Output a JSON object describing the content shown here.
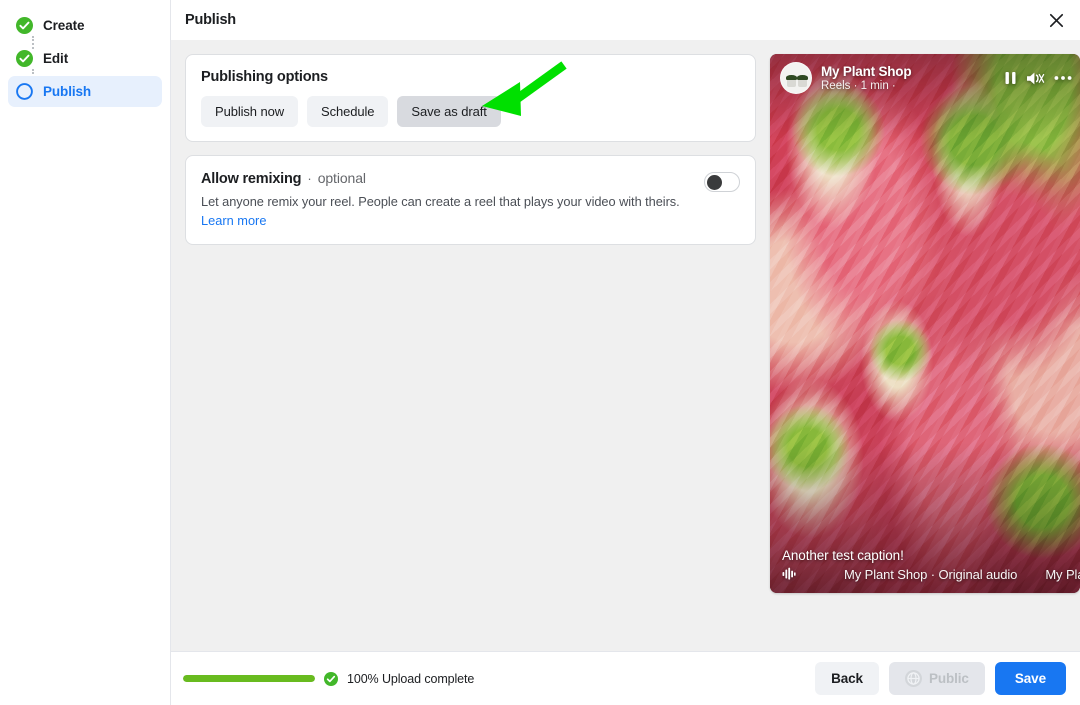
{
  "accent": {
    "blue": "#1877f2",
    "green": "#42b72a",
    "progress_green": "#68bb1f",
    "annotation_green": "#00e000",
    "selected_step_bg": "#e7f0fd"
  },
  "sidebar": {
    "steps": [
      {
        "label": "Create",
        "icon": "check-circle-filled-icon",
        "state": "complete"
      },
      {
        "label": "Edit",
        "icon": "check-circle-filled-icon",
        "state": "complete"
      },
      {
        "label": "Publish",
        "icon": "circle-outline-icon",
        "state": "active"
      }
    ]
  },
  "topbar": {
    "title": "Publish",
    "close_icon": "close-icon"
  },
  "publishing_options": {
    "title": "Publishing options",
    "buttons": [
      {
        "label": "Publish now",
        "selected": false
      },
      {
        "label": "Schedule",
        "selected": false
      },
      {
        "label": "Save as draft",
        "selected": true
      }
    ]
  },
  "allow_remixing": {
    "title": "Allow remixing",
    "separator": "·",
    "optional_label": "optional",
    "description": "Let anyone remix your reel. People can create a reel that plays your video with theirs.",
    "learn_more": "Learn more",
    "toggle_on": false
  },
  "preview": {
    "account_name": "My Plant Shop",
    "subtitle": "Reels · 1 min ·",
    "avatar_icon": "plant-shop-avatar",
    "controls": [
      {
        "icon": "pause-icon"
      },
      {
        "icon": "speaker-muted-icon"
      },
      {
        "icon": "more-options-icon"
      }
    ],
    "caption": "Another test caption!",
    "audio_icon": "audio-waveform-icon",
    "audio_label": "My Plant Shop · Original audio",
    "audio_label_repeat": "My Plant Shop · Original audio"
  },
  "footer": {
    "progress_percent": 100,
    "upload_status": "100% Upload complete",
    "upload_status_icon": "check-circle-filled-icon",
    "back_label": "Back",
    "audience_label": "Public",
    "audience_icon": "globe-icon",
    "save_label": "Save"
  },
  "annotation": {
    "type": "arrow",
    "points_to": "Save as draft",
    "color": "#00e000"
  }
}
